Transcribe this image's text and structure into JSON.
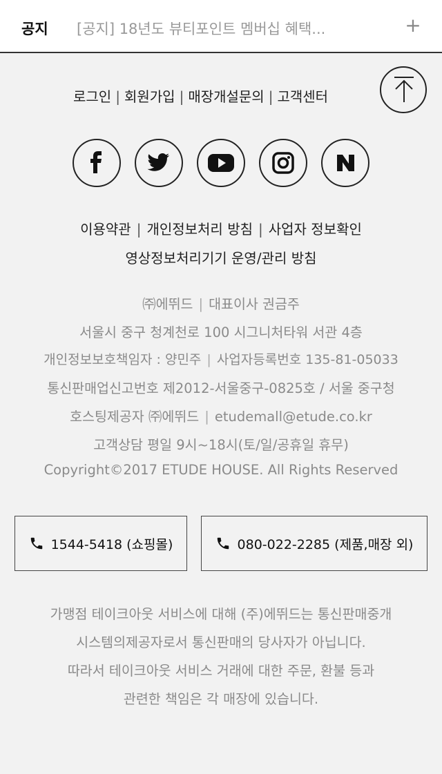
{
  "notice": {
    "label": "공지",
    "text": "[공지] 18년도 뷰티포인트 멤버십 혜택...",
    "expand_symbol": "+"
  },
  "top_links": {
    "login": "로그인",
    "signup": "회원가입",
    "store_inquiry": "매장개설문의",
    "customer_center": "고객센터",
    "separator": "|"
  },
  "social": {
    "items": [
      {
        "name": "facebook-icon"
      },
      {
        "name": "twitter-icon"
      },
      {
        "name": "youtube-icon"
      },
      {
        "name": "instagram-icon"
      },
      {
        "name": "naver-icon"
      }
    ]
  },
  "policy": {
    "terms": "이용약관",
    "privacy": "개인정보처리 방침",
    "business_info": "사업자 정보확인",
    "cctv_policy": "영상정보처리기기 운영/관리 방침",
    "separator": "|"
  },
  "company": {
    "name": "㈜에뛰드",
    "ceo": "대표이사 권금주",
    "address": "서울시 중구 청계천로 100 시그니처타워 서관 4층",
    "privacy_officer": "개인정보보호책임자 : 양민주",
    "business_number": "사업자등록번호 135-81-05033",
    "mail_order_number": "통신판매업신고번호 제2012-서울중구-0825호 / 서울 중구청",
    "hosting": "호스팅제공자 ㈜에뛰드",
    "email": "etudemall@etude.co.kr",
    "hours": "고객상담 평일 9시~18시(토/일/공휴일 휴무)",
    "copyright": "Copyright©2017 ETUDE HOUSE. All Rights Reserved",
    "separator": "|"
  },
  "phones": {
    "shopping": "1544-5418 (쇼핑몰)",
    "product_store": "080-022-2285 (제품,매장 외)"
  },
  "disclaimer": {
    "line1": "가맹점 테이크아웃 서비스에 대해 (주)에뛰드는 통신판매중개",
    "line2": "시스템의제공자로서 통신판매의 당사자가 아닙니다.",
    "line3": "따라서 테이크아웃 서비스 거래에 대한 주문, 환불 등과",
    "line4": "관련한 책임은 각 매장에 있습니다."
  },
  "colors": {
    "background": "#f2f2f2",
    "text_dark": "#222222",
    "text_muted": "#8a8a8a"
  }
}
